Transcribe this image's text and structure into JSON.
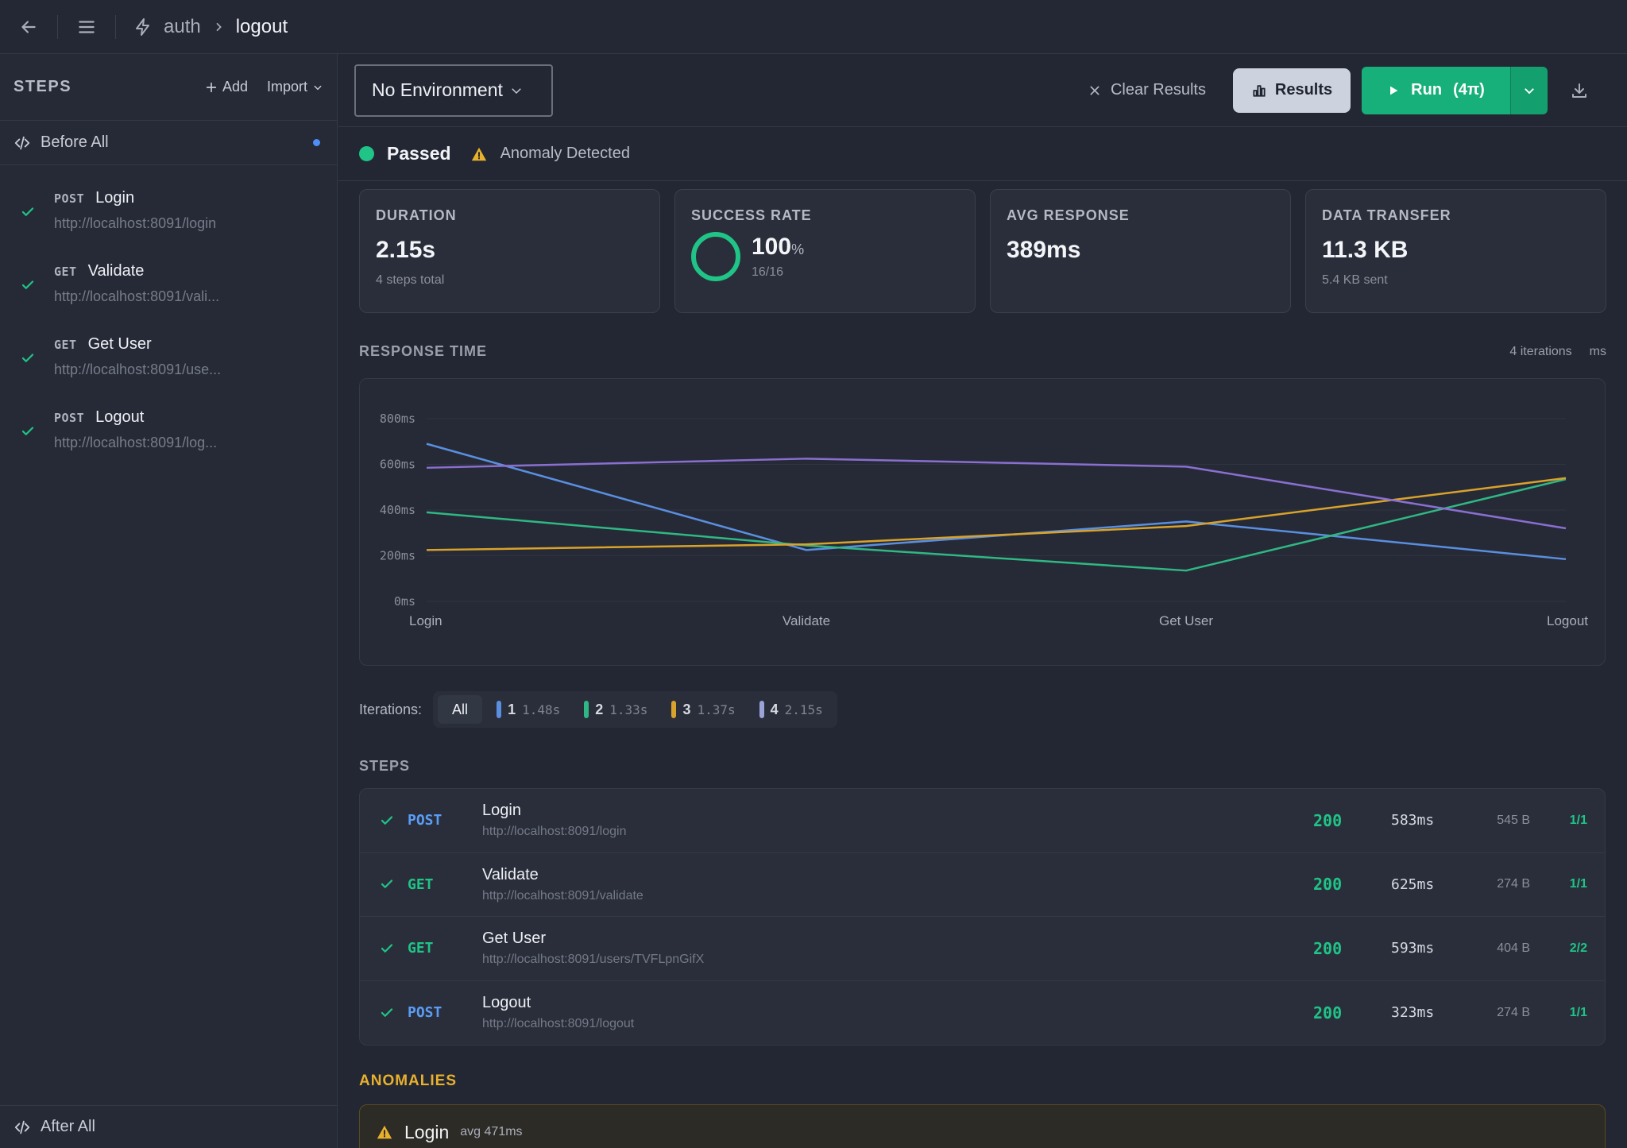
{
  "breadcrumb": {
    "collection": "auth",
    "current": "logout"
  },
  "sidebar": {
    "title": "STEPS",
    "add_label": "Add",
    "import_label": "Import",
    "before_all": "Before All",
    "after_all": "After All",
    "steps": [
      {
        "method": "POST",
        "name": "Login",
        "url": "http://localhost:8091/login"
      },
      {
        "method": "GET",
        "name": "Validate",
        "url": "http://localhost:8091/vali..."
      },
      {
        "method": "GET",
        "name": "Get User",
        "url": "http://localhost:8091/use..."
      },
      {
        "method": "POST",
        "name": "Logout",
        "url": "http://localhost:8091/log..."
      }
    ]
  },
  "toolbar": {
    "environment": "No Environment",
    "clear_label": "Clear Results",
    "results_label": "Results",
    "run_label": "Run",
    "run_count": "(4π)"
  },
  "status": {
    "result": "Passed",
    "anomaly": "Anomaly Detected"
  },
  "cards": {
    "duration": {
      "label": "DURATION",
      "value": "2.15s",
      "sub": "4 steps total"
    },
    "success": {
      "label": "SUCCESS RATE",
      "value": "100",
      "unit": "%",
      "sub": "16/16"
    },
    "avg": {
      "label": "AVG RESPONSE",
      "value": "389ms"
    },
    "transfer": {
      "label": "DATA TRANSFER",
      "value": "11.3 KB",
      "sub": "5.4 KB sent"
    }
  },
  "response_time": {
    "title": "RESPONSE TIME",
    "iterations": "4 iterations",
    "unit": "ms"
  },
  "chart_data": {
    "type": "line",
    "categories": [
      "Login",
      "Validate",
      "Get User",
      "Logout"
    ],
    "y_ticks": [
      "0ms",
      "200ms",
      "400ms",
      "600ms",
      "800ms"
    ],
    "ylim": [
      0,
      800
    ],
    "series": [
      {
        "color": "#5a8fe0",
        "values": [
          690,
          225,
          350,
          185
        ]
      },
      {
        "color": "#2fb884",
        "values": [
          390,
          245,
          135,
          535
        ]
      },
      {
        "color": "#d9a32b",
        "values": [
          225,
          250,
          330,
          540
        ]
      },
      {
        "color": "#8a6fd0",
        "values": [
          585,
          625,
          590,
          320
        ]
      }
    ]
  },
  "iterations": {
    "label": "Iterations:",
    "all_label": "All",
    "items": [
      {
        "num": "1",
        "time": "1.48s",
        "color": "#5a8fe0"
      },
      {
        "num": "2",
        "time": "1.33s",
        "color": "#2fb884"
      },
      {
        "num": "3",
        "time": "1.37s",
        "color": "#d9a32b"
      },
      {
        "num": "4",
        "time": "2.15s",
        "color": "#9aa3d8"
      }
    ]
  },
  "steps_section": {
    "title": "STEPS",
    "rows": [
      {
        "method": "POST",
        "name": "Login",
        "url": "http://localhost:8091/login",
        "code": "200",
        "time": "583ms",
        "size": "545 B",
        "ratio": "1/1"
      },
      {
        "method": "GET",
        "name": "Validate",
        "url": "http://localhost:8091/validate",
        "code": "200",
        "time": "625ms",
        "size": "274 B",
        "ratio": "1/1"
      },
      {
        "method": "GET",
        "name": "Get User",
        "url": "http://localhost:8091/users/TVFLpnGifX",
        "code": "200",
        "time": "593ms",
        "size": "404 B",
        "ratio": "2/2"
      },
      {
        "method": "POST",
        "name": "Logout",
        "url": "http://localhost:8091/logout",
        "code": "200",
        "time": "323ms",
        "size": "274 B",
        "ratio": "1/1"
      }
    ]
  },
  "anomalies": {
    "title": "ANOMALIES",
    "items": [
      {
        "name": "Login",
        "detail": "avg 471ms"
      }
    ]
  }
}
